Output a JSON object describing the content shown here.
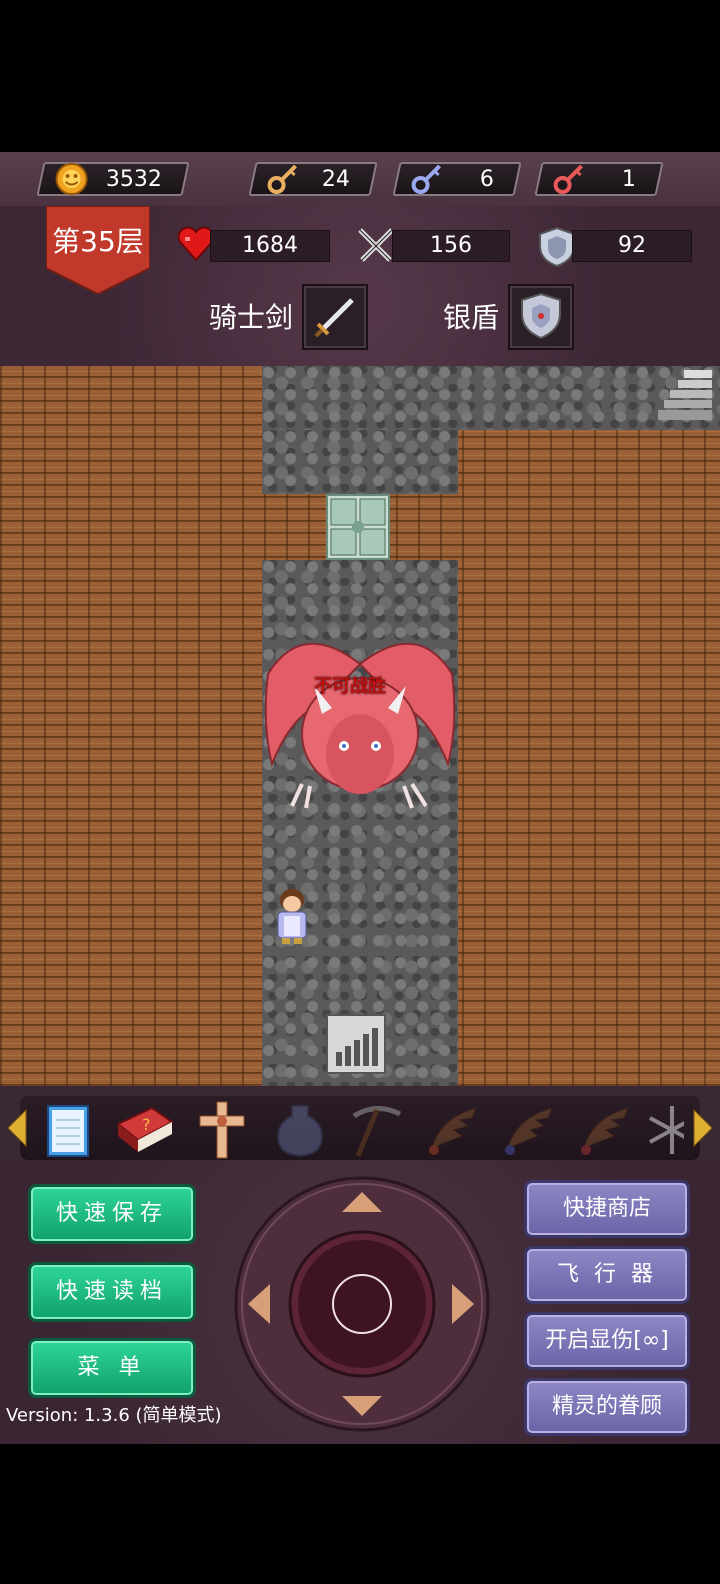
{
  "resources": {
    "gold": "3532",
    "yellow_key": "24",
    "blue_key": "6",
    "red_key": "1"
  },
  "status": {
    "floor": "第35层",
    "hp": "1684",
    "attack": "156",
    "defense": "92"
  },
  "equipment": {
    "weapon": "骑士剑",
    "shield": "银盾"
  },
  "map": {
    "monster_label": "不可战胜"
  },
  "items": [
    "notebook-icon",
    "monster-manual-icon",
    "holy-cross-icon",
    "water-jar-icon",
    "pickaxe-icon",
    "flight-wing-up-icon",
    "flight-wing-down-icon",
    "flight-wing-center-icon",
    "snowflake-icon"
  ],
  "buttons": {
    "quick_save": "快速保存",
    "quick_load": "快速读档",
    "menu": "菜 单",
    "quick_shop": "快捷商店",
    "flyer": "飞 行 器",
    "show_damage": "开启显伤[∞]",
    "fairy_favor": "精灵的眷顾"
  },
  "version": "Version: 1.3.6 (简单模式)"
}
